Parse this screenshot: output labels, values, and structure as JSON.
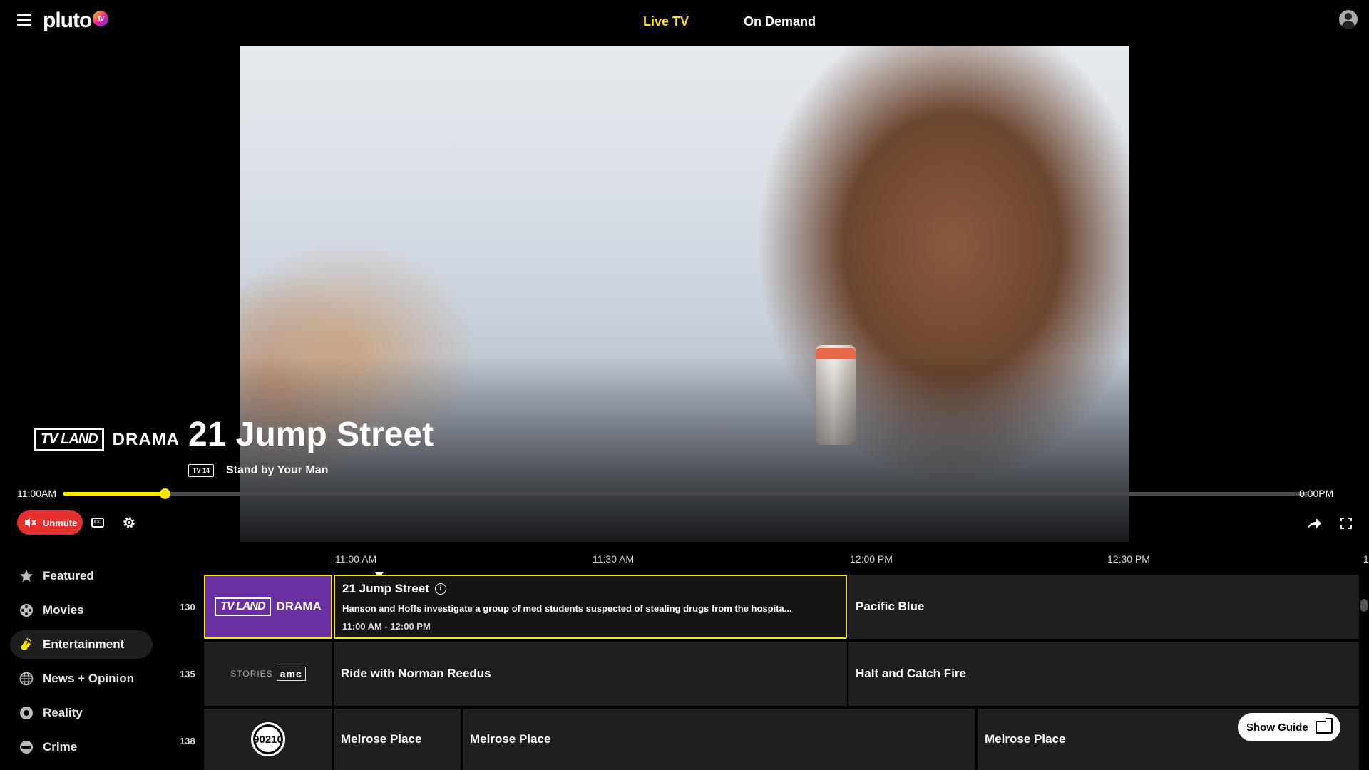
{
  "header": {
    "logo_text": "pluto",
    "logo_badge": "tv",
    "tabs": [
      {
        "label": "Live TV",
        "active": true
      },
      {
        "label": "On Demand",
        "active": false
      }
    ]
  },
  "player": {
    "channel_badge": "TV LAND",
    "channel_name": "DRAMA",
    "title": "21 Jump Street",
    "rating": "TV-14",
    "episode": "Stand by Your Man",
    "time_start": "11:00AM",
    "time_end": "0:00PM",
    "progress_fraction": 0.082,
    "unmute_label": "Unmute",
    "cc_label": "CC",
    "accent_color": "#ffe600",
    "unmute_color": "#e5302d"
  },
  "sidebar": {
    "items": [
      {
        "label": "Featured",
        "icon": "star-icon"
      },
      {
        "label": "Movies",
        "icon": "film-reel-icon"
      },
      {
        "label": "Entertainment",
        "icon": "clapping-hands-icon",
        "active": true
      },
      {
        "label": "News + Opinion",
        "icon": "globe-icon"
      },
      {
        "label": "Reality",
        "icon": "reality-icon"
      },
      {
        "label": "Crime",
        "icon": "mask-icon"
      }
    ]
  },
  "guide": {
    "time_slots": [
      "11:00 AM",
      "11:30 AM",
      "12:00 PM",
      "12:30 PM",
      "1"
    ],
    "rows": [
      {
        "number": "130",
        "channel": {
          "badge": "TV LAND",
          "name": "DRAMA"
        },
        "programs": [
          {
            "title": "21 Jump Street",
            "description": "Hanson and Hoffs investigate a group of med students suspected of stealing drugs from the hospita...",
            "time": "11:00 AM - 12:00 PM"
          },
          {
            "title": "Pacific Blue"
          }
        ]
      },
      {
        "number": "135",
        "channel": {
          "prefix": "STORIES",
          "brand": "amc"
        },
        "programs": [
          {
            "title": "Ride with Norman Reedus"
          },
          {
            "title": "Halt and Catch Fire"
          }
        ]
      },
      {
        "number": "138",
        "channel": {
          "brand": "90210"
        },
        "programs": [
          {
            "title": "Melrose Place"
          },
          {
            "title": "Melrose Place"
          },
          {
            "title": "Melrose Place"
          }
        ]
      }
    ],
    "show_guide_label": "Show Guide"
  }
}
